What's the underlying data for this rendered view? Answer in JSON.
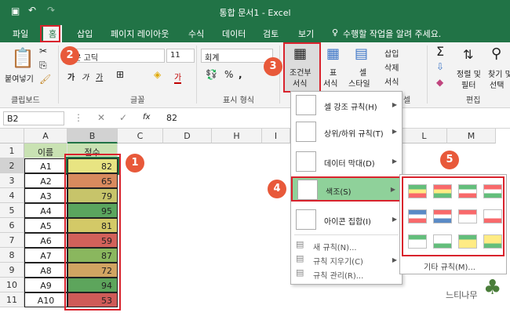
{
  "title_bar": {
    "title": "통합 문서1 - Excel"
  },
  "tabs": [
    "파일",
    "홈",
    "삽입",
    "페이지 레이아웃",
    "수식",
    "데이터",
    "검토",
    "보기"
  ],
  "tell_me": "수행할 작업을 알려 주세요.",
  "ribbon": {
    "paste_label": "붙여넣기",
    "clipboard_label": "클립보드",
    "font_name": "맑은 고딕",
    "font_size": "11",
    "font_group_label": "글꼴",
    "bold": "가",
    "italic": "가",
    "underline": "가",
    "font_color": "가",
    "number_format": "회계",
    "number_group_label": "표시 형식",
    "cond_format_label": "조건부",
    "cond_format_label2": "서식",
    "table_format_label": "표",
    "table_format_label2": "서식",
    "cell_style_label": "셀",
    "cell_style_label2": "스타일",
    "insert_label": "삽입",
    "delete_label": "삭제",
    "format_label": "서식",
    "cells_group_label": "셀",
    "sort_label": "정렬 및",
    "sort_label2": "필터",
    "find_label": "찾기 및",
    "find_label2": "선택",
    "edit_group_label": "편집"
  },
  "formula_bar": {
    "name_box": "B2",
    "fx": "fx",
    "value": "82"
  },
  "columns": [
    "A",
    "B",
    "C",
    "D",
    "H",
    "I",
    "L",
    "M"
  ],
  "header_row": {
    "name": "이름",
    "score": "점수"
  },
  "rows": [
    {
      "n": "1"
    },
    {
      "n": "2",
      "a": "A1",
      "b": "82",
      "color": "#e8e482"
    },
    {
      "n": "3",
      "a": "A2",
      "b": "65",
      "color": "#d88a5e"
    },
    {
      "n": "4",
      "a": "A3",
      "b": "79",
      "color": "#c7c46a"
    },
    {
      "n": "5",
      "a": "A4",
      "b": "95",
      "color": "#5aa55e"
    },
    {
      "n": "6",
      "a": "A5",
      "b": "81",
      "color": "#d3c967"
    },
    {
      "n": "7",
      "a": "A6",
      "b": "59",
      "color": "#d2615a"
    },
    {
      "n": "8",
      "a": "A7",
      "b": "87",
      "color": "#8ab75e"
    },
    {
      "n": "9",
      "a": "A8",
      "b": "72",
      "color": "#d1a462"
    },
    {
      "n": "10",
      "a": "A9",
      "b": "94",
      "color": "#5da55c"
    },
    {
      "n": "11",
      "a": "A10",
      "b": "53",
      "color": "#cf5b58"
    }
  ],
  "menu": {
    "highlight": "셀 강조 규칙(H)",
    "topbottom": "상위/하위 규칙(T)",
    "databar": "데이터 막대(D)",
    "colorscale": "색조(S)",
    "iconset": "아이콘 집합(I)",
    "new_rule": "새 규칙(N)...",
    "clear_rule": "규칙 지우기(C)",
    "manage_rule": "규칙 관리(R)..."
  },
  "submenu": {
    "more": "기타 규칙(M)..."
  },
  "callouts": [
    "1",
    "2",
    "3",
    "4",
    "5"
  ],
  "watermark": "느티나무"
}
